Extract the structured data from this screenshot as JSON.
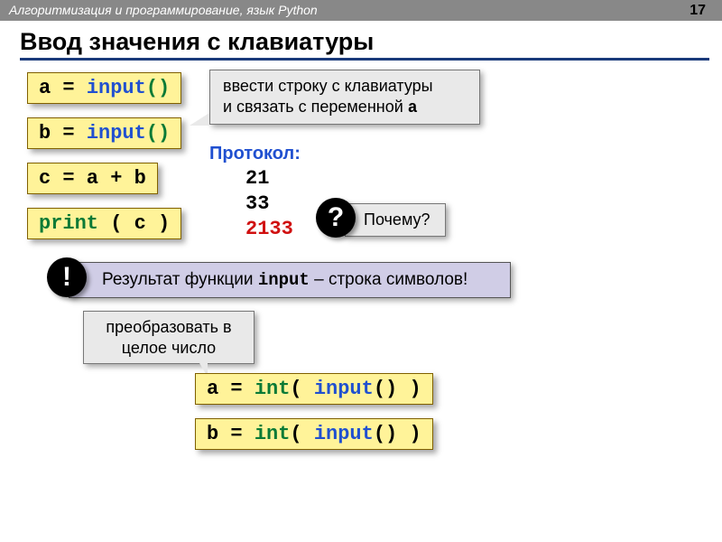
{
  "header": {
    "course": "Алгоритмизация и программирование, язык Python",
    "page": "17"
  },
  "title": "Ввод значения с клавиатуры",
  "code": {
    "line1_a": "a",
    "line1_eq": " = ",
    "line1_fn": "input",
    "line1_par": "()",
    "line2_b": "b",
    "line2_eq": " = ",
    "line2_fn": "input",
    "line2_par": "()",
    "line3": "c = a + b",
    "line4_fn": "print",
    "line4_arg": " ( c )"
  },
  "callout1_l1": "ввести строку с клавиатуры",
  "callout1_l2": "и связать с переменной ",
  "callout1_var": "a",
  "protocol": {
    "label": "Протокол:",
    "v1": "21",
    "v2": "33",
    "v3": "2133"
  },
  "why": "Почему?",
  "question": "?",
  "bang": "!",
  "result_pre": "Результат функции ",
  "result_fn": "input",
  "result_post": " – строка символов!",
  "convert": "преобразовать в целое число",
  "int_lines": {
    "a_var": "a",
    "a_eq": " = ",
    "a_int": "int",
    "a_open": "( ",
    "a_input": "input",
    "a_close": "() )",
    "b_var": "b",
    "b_eq": " = ",
    "b_int": "int",
    "b_open": "( ",
    "b_input": "input",
    "b_close": "() )"
  }
}
